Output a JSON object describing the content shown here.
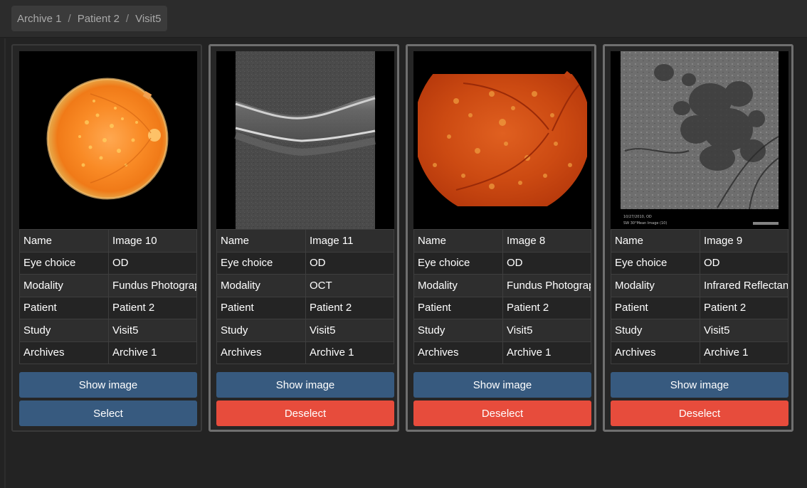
{
  "breadcrumb": {
    "items": [
      "Archive 1",
      "Patient 2",
      "Visit5"
    ],
    "separator": "/"
  },
  "fields": [
    "Name",
    "Eye choice",
    "Modality",
    "Patient",
    "Study",
    "Archives"
  ],
  "buttons": {
    "show_image": "Show image",
    "select": "Select",
    "deselect": "Deselect"
  },
  "cards": [
    {
      "selected": false,
      "image_type": "fundus-photo",
      "values": [
        "Image 10",
        "OD",
        "Fundus Photograp",
        "Patient 2",
        "Visit5",
        "Archive 1"
      ]
    },
    {
      "selected": true,
      "image_type": "oct-scan",
      "values": [
        "Image 11",
        "OD",
        "OCT",
        "Patient 2",
        "Visit5",
        "Archive 1"
      ]
    },
    {
      "selected": true,
      "image_type": "fundus-photo",
      "values": [
        "Image 8",
        "OD",
        "Fundus Photograp",
        "Patient 2",
        "Visit5",
        "Archive 1"
      ]
    },
    {
      "selected": true,
      "image_type": "infrared-reflectance",
      "values": [
        "Image 9",
        "OD",
        "Infrared Reflectan",
        "Patient 2",
        "Visit5",
        "Archive 1"
      ],
      "image_caption": "10/27/2010, OD",
      "image_subcaption": "SW  30°Mean Image (10)"
    }
  ],
  "colors": {
    "primary_button": "#375a7f",
    "danger_button": "#e74c3c",
    "background": "#232323"
  }
}
